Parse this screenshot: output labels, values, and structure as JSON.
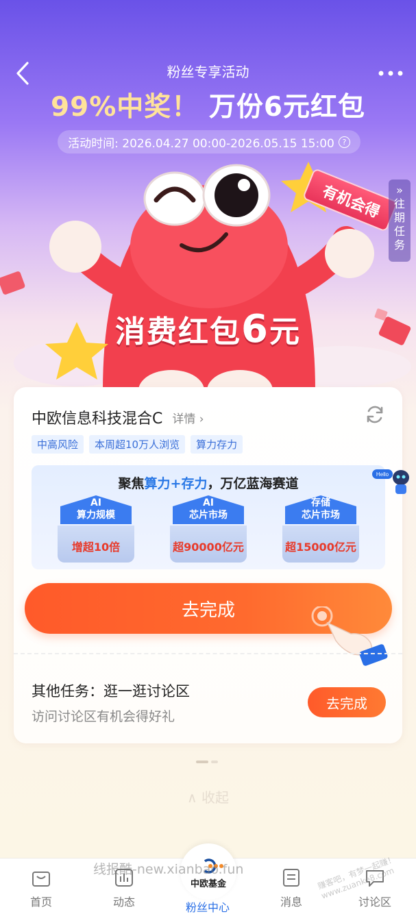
{
  "header": {
    "title": "粉丝专享活动",
    "headline_a": "99%中奖！",
    "headline_b": "万份6元红包",
    "time": "活动时间: 2026.04.27 00:00-2026.05.15 15:00",
    "help_glyph": "?"
  },
  "hero": {
    "side_tab": [
      "»",
      "往",
      "期",
      "任",
      "务"
    ],
    "badge": "有机会得",
    "label": "消费红包",
    "amount": "6",
    "unit": "元"
  },
  "card": {
    "fund_name": "中欧信息科技混合C",
    "detail": "详情 ›",
    "tags": [
      "中高风险",
      "本周超10万人浏览",
      "算力存力"
    ],
    "banner": {
      "title_a": "聚焦",
      "title_b": "算力+存力",
      "title_c": "，万亿蓝海赛道",
      "pillars": [
        {
          "line1": "AI",
          "line2": "算力规模",
          "value": "增超10倍"
        },
        {
          "line1": "AI",
          "line2": "芯片市场",
          "value": "超90000亿元"
        },
        {
          "line1": "存储",
          "line2": "芯片市场",
          "value": "超15000亿元"
        }
      ]
    },
    "bot_label": "Hello",
    "main_button": "去完成",
    "other_title": "其他任务：逛一逛讨论区",
    "other_sub": "访问讨论区有机会得好礼",
    "other_button": "去完成"
  },
  "collapse_label": "∧ 收起",
  "tabbar": {
    "tabs": [
      "首页",
      "动态",
      "粉丝中心",
      "消息",
      "讨论区"
    ],
    "center_logo": "中欧基金",
    "active": "粉丝中心"
  },
  "watermark": "线报酷-new.xianbao.fun",
  "watermark2": "赚客吧，有梦一起赚！ www.zuanke8.com"
}
